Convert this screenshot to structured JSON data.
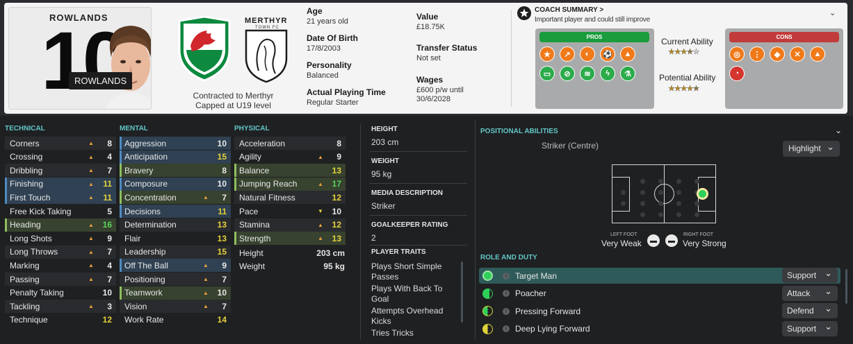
{
  "header": {
    "player_name": "ROWLANDS",
    "shirt_number": "10",
    "name_tag": "ROWLANDS",
    "contract_line1": "Contracted to Merthyr",
    "contract_line2": "Capped at U19 level",
    "club_crest_text1": "MERTHYR",
    "club_crest_text2": "TOWN FC"
  },
  "info": {
    "age_label": "Age",
    "age_value": "21 years old",
    "dob_label": "Date Of Birth",
    "dob_value": "17/8/2003",
    "personality_label": "Personality",
    "personality_value": "Balanced",
    "apt_label": "Actual Playing Time",
    "apt_value": "Regular Starter",
    "value_label": "Value",
    "value_value": "£18.75K",
    "transfer_label": "Transfer Status",
    "transfer_value": "Not set",
    "wages_label": "Wages",
    "wages_value1": "£600 p/w until",
    "wages_value2": "30/6/2028"
  },
  "coach": {
    "title": "COACH SUMMARY",
    "chevron": ">",
    "desc": "Important player and could still improve",
    "pros_label": "PROS",
    "cons_label": "CONS",
    "current_ability_label": "Current Ability",
    "current_ability_stars": 3.5,
    "potential_ability_label": "Potential Ability",
    "potential_ability_stars": 4.5,
    "pros_icons": [
      "star-icon",
      "trend-icon",
      "head-icon",
      "kick-icon",
      "cone-icon",
      "pitch-icon",
      "bandage-icon",
      "ladder-icon",
      "bolt-icon",
      "flask-icon"
    ],
    "cons_icons": [
      "target-icon",
      "foot-icon",
      "boot-icon",
      "tackle-icon",
      "cone-icon",
      "whistle-icon"
    ],
    "pros_color": "#1a9c3c",
    "cons_color": "#c23b3b",
    "icon_orange": "#f07a1a",
    "icon_green": "#2cab4b"
  },
  "technical": {
    "heading": "TECHNICAL",
    "rows": [
      {
        "name": "Corners",
        "value": "8",
        "trend": "up"
      },
      {
        "name": "Crossing",
        "value": "4",
        "trend": "up"
      },
      {
        "name": "Dribbling",
        "value": "7",
        "trend": "up"
      },
      {
        "name": "Finishing",
        "value": "11",
        "trend": "up"
      },
      {
        "name": "First Touch",
        "value": "11",
        "trend": "up"
      },
      {
        "name": "Free Kick Taking",
        "value": "5",
        "trend": ""
      },
      {
        "name": "Heading",
        "value": "16",
        "trend": "up"
      },
      {
        "name": "Long Shots",
        "value": "9",
        "trend": "up"
      },
      {
        "name": "Long Throws",
        "value": "7",
        "trend": "up"
      },
      {
        "name": "Marking",
        "value": "4",
        "trend": "up"
      },
      {
        "name": "Passing",
        "value": "7",
        "trend": "up"
      },
      {
        "name": "Penalty Taking",
        "value": "10",
        "trend": ""
      },
      {
        "name": "Tackling",
        "value": "3",
        "trend": "up"
      },
      {
        "name": "Technique",
        "value": "12",
        "trend": ""
      }
    ]
  },
  "mental": {
    "heading": "MENTAL",
    "rows": [
      {
        "name": "Aggression",
        "value": "10",
        "trend": ""
      },
      {
        "name": "Anticipation",
        "value": "15",
        "trend": ""
      },
      {
        "name": "Bravery",
        "value": "8",
        "trend": ""
      },
      {
        "name": "Composure",
        "value": "10",
        "trend": ""
      },
      {
        "name": "Concentration",
        "value": "7",
        "trend": "up"
      },
      {
        "name": "Decisions",
        "value": "11",
        "trend": ""
      },
      {
        "name": "Determination",
        "value": "13",
        "trend": ""
      },
      {
        "name": "Flair",
        "value": "13",
        "trend": ""
      },
      {
        "name": "Leadership",
        "value": "15",
        "trend": ""
      },
      {
        "name": "Off The Ball",
        "value": "9",
        "trend": "up"
      },
      {
        "name": "Positioning",
        "value": "7",
        "trend": "up"
      },
      {
        "name": "Teamwork",
        "value": "10",
        "trend": "up"
      },
      {
        "name": "Vision",
        "value": "7",
        "trend": "up"
      },
      {
        "name": "Work Rate",
        "value": "14",
        "trend": ""
      }
    ]
  },
  "physical": {
    "heading": "PHYSICAL",
    "rows": [
      {
        "name": "Acceleration",
        "value": "8",
        "trend": ""
      },
      {
        "name": "Agility",
        "value": "9",
        "trend": "up"
      },
      {
        "name": "Balance",
        "value": "13",
        "trend": ""
      },
      {
        "name": "Jumping Reach",
        "value": "17",
        "trend": "up"
      },
      {
        "name": "Natural Fitness",
        "value": "12",
        "trend": ""
      },
      {
        "name": "Pace",
        "value": "10",
        "trend": "down"
      },
      {
        "name": "Stamina",
        "value": "12",
        "trend": "up"
      },
      {
        "name": "Strength",
        "value": "13",
        "trend": "up"
      }
    ],
    "height_label": "Height",
    "height_value": "203 cm",
    "weight_label": "Weight",
    "weight_value": "95 kg"
  },
  "details": {
    "height_heading": "HEIGHT",
    "height_value": "203 cm",
    "weight_heading": "WEIGHT",
    "weight_value": "95 kg",
    "media_heading": "MEDIA DESCRIPTION",
    "media_value": "Striker",
    "gk_heading": "GOALKEEPER RATING",
    "gk_value": "2",
    "traits_heading": "PLAYER TRAITS",
    "traits": [
      "Plays Short Simple Passes",
      "Plays With Back To Goal",
      "Attempts Overhead Kicks",
      "Tries Tricks"
    ]
  },
  "positions": {
    "heading": "POSITIONAL ABILITIES",
    "position": "Striker (Centre)",
    "highlight_label": "Highlight",
    "left_foot_label": "LEFT FOOT",
    "left_foot_value": "Very Weak",
    "right_foot_label": "RIGHT FOOT",
    "right_foot_value": "Very Strong"
  },
  "roles": {
    "heading": "ROLE AND DUTY",
    "items": [
      {
        "name": "Target Man",
        "duty": "Support",
        "level": "full"
      },
      {
        "name": "Poacher",
        "duty": "Attack",
        "level": "high"
      },
      {
        "name": "Pressing Forward",
        "duty": "Defend",
        "level": "mid"
      },
      {
        "name": "Deep Lying Forward",
        "duty": "Support",
        "level": "low"
      }
    ]
  }
}
